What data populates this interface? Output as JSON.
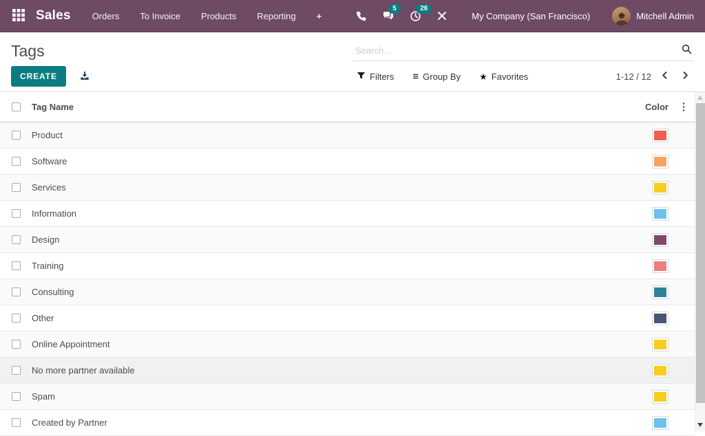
{
  "colors": {
    "navbar_bg": "#6e4a64",
    "accent_teal": "#0b7d80",
    "badge_bg": "#0c7d84"
  },
  "icons": {
    "plus": "+",
    "group_by": "≡",
    "favorites_star": "★",
    "kebab": "⋮"
  },
  "nav": {
    "app_name": "Sales",
    "menus": [
      "Orders",
      "To Invoice",
      "Products",
      "Reporting"
    ],
    "messages_count": "5",
    "activities_count": "26",
    "company": "My Company (San Francisco)",
    "user": "Mitchell Admin"
  },
  "control": {
    "title": "Tags",
    "search_placeholder": "Search...",
    "create_label": "CREATE",
    "filters_label": "Filters",
    "groupby_label": "Group By",
    "favorites_label": "Favorites",
    "pager": "1-12 / 12"
  },
  "table": {
    "columns": {
      "name": "Tag Name",
      "color": "Color"
    },
    "rows": [
      {
        "name": "Product",
        "color": "#F06050"
      },
      {
        "name": "Software",
        "color": "#F4A460"
      },
      {
        "name": "Services",
        "color": "#F7CD1F"
      },
      {
        "name": "Information",
        "color": "#6CC1ED"
      },
      {
        "name": "Design",
        "color": "#814968"
      },
      {
        "name": "Training",
        "color": "#EB7E7F"
      },
      {
        "name": "Consulting",
        "color": "#2C8397"
      },
      {
        "name": "Other",
        "color": "#475577"
      },
      {
        "name": "Online Appointment",
        "color": "#F7CD1F"
      },
      {
        "name": "No more partner available",
        "color": "#F7CD1F",
        "highlighted": true
      },
      {
        "name": "Spam",
        "color": "#F7CD1F"
      },
      {
        "name": "Created by Partner",
        "color": "#6CC1ED"
      }
    ]
  }
}
